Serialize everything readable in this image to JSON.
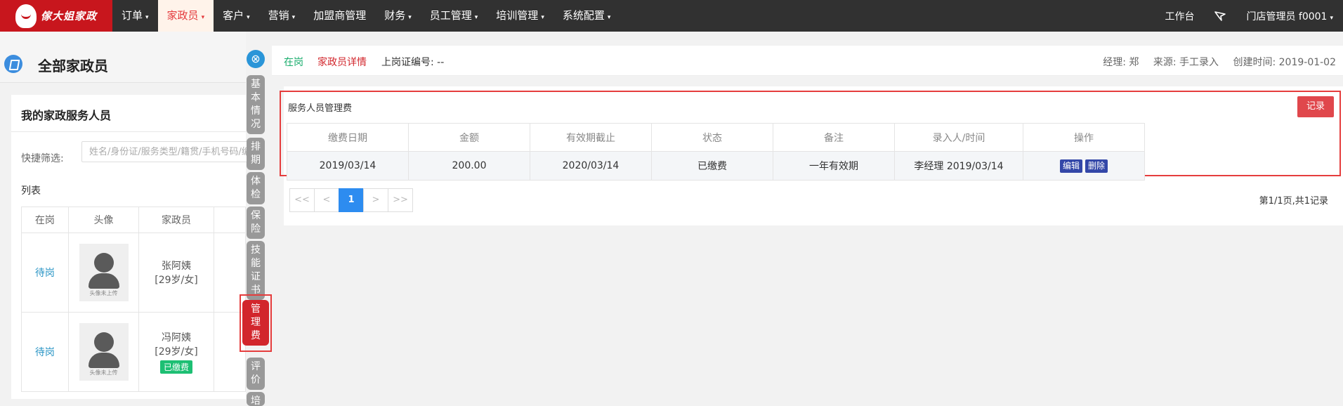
{
  "brand": {
    "logo_text": "傢大姐家政"
  },
  "nav": {
    "items": [
      {
        "label": "订单",
        "caret": "▾"
      },
      {
        "label": "家政员",
        "caret": "▾"
      },
      {
        "label": "客户",
        "caret": "▾"
      },
      {
        "label": "营销",
        "caret": "▾"
      },
      {
        "label": "加盟商管理",
        "caret": ""
      },
      {
        "label": "财务",
        "caret": "▾"
      },
      {
        "label": "员工管理",
        "caret": "▾"
      },
      {
        "label": "培训管理",
        "caret": "▾"
      },
      {
        "label": "系统配置",
        "caret": "▾"
      }
    ],
    "active_index": 1,
    "workbench": "工作台",
    "user": "门店管理员  f0001",
    "user_caret": "▾",
    "bg_color": "#313131",
    "logo_color": "#c8161d"
  },
  "left": {
    "title": "全部家政员",
    "card_title": "我的家政服务人员",
    "filter_label": "快捷筛选:",
    "filter_placeholder": "姓名/身份证/服务类型/籍贯/手机号码/编号",
    "list_label": "列表",
    "columns": [
      "在岗",
      "头像",
      "家政员"
    ],
    "rows": [
      {
        "status": "待岗",
        "avatar_caption": "头像未上传",
        "name": "张阿姨",
        "info": "[29岁/女]",
        "badge": ""
      },
      {
        "status": "待岗",
        "avatar_caption": "头像未上传",
        "name": "冯阿姨",
        "info": "[29岁/女]",
        "badge": "已缴费"
      }
    ]
  },
  "vtabs": {
    "close_icon": "⊗",
    "items": [
      "基本情况",
      "排期",
      "体检",
      "保险",
      "技能证书",
      "管理费",
      "评价",
      "培训"
    ],
    "active_index": 5
  },
  "detail": {
    "status": "在岗",
    "tab_label": "家政员详情",
    "cert_label": "上岗证编号: --",
    "manager": "经理: 郑",
    "source": "来源: 手工录入",
    "created": "创建时间: 2019-01-02",
    "section_title": "服务人员管理费",
    "add_button": "记录",
    "columns": [
      "缴费日期",
      "金额",
      "有效期截止",
      "状态",
      "备注",
      "录入人/时间",
      "操作"
    ],
    "rows": [
      {
        "date": "2019/03/14",
        "amount": "200.00",
        "expire": "2020/03/14",
        "status": "已缴费",
        "note": "一年有效期",
        "entry": "李经理 2019/03/14",
        "edit": "编辑",
        "delete": "删除"
      }
    ],
    "pager": [
      "<<",
      "<",
      "1",
      ">",
      ">>"
    ],
    "page_info": "第1/1页,共1记录",
    "accent": "#d2262c",
    "paid_color": "#1aad2b"
  }
}
